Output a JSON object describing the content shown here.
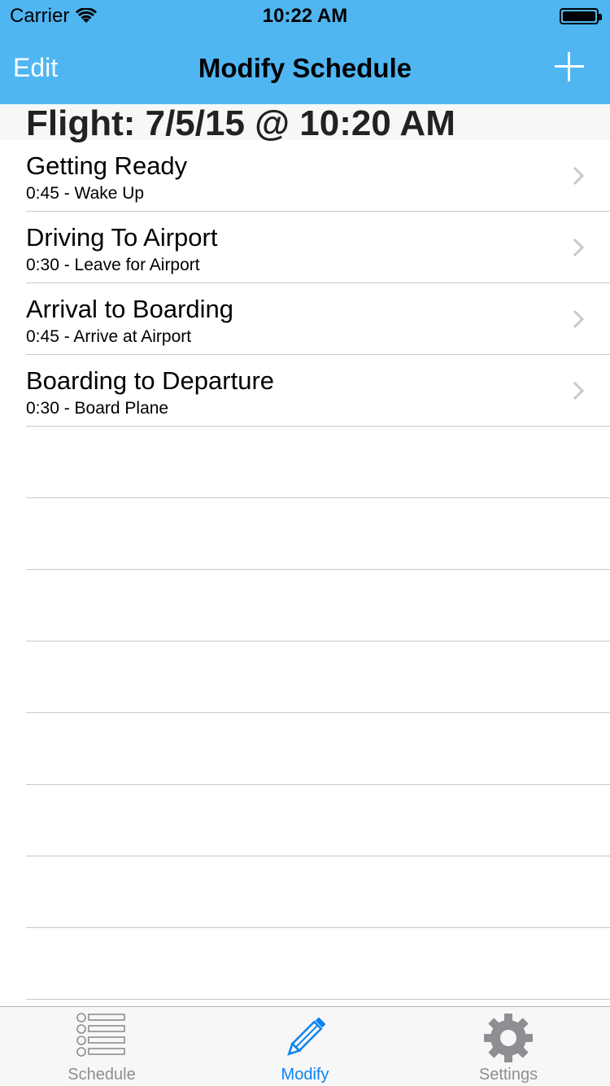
{
  "status": {
    "carrier": "Carrier",
    "time": "10:22 AM"
  },
  "nav": {
    "left": "Edit",
    "title": "Modify Schedule",
    "right_icon": "plus-icon"
  },
  "section": {
    "title": "Flight: 7/5/15 @ 10:20 AM"
  },
  "rows": [
    {
      "title": "Getting Ready",
      "subtitle": "0:45 - Wake Up"
    },
    {
      "title": "Driving To Airport",
      "subtitle": "0:30 - Leave for Airport"
    },
    {
      "title": "Arrival to Boarding",
      "subtitle": "0:45 - Arrive at Airport"
    },
    {
      "title": "Boarding to Departure",
      "subtitle": "0:30 - Board Plane"
    }
  ],
  "tabs": [
    {
      "label": "Schedule",
      "icon": "list-icon",
      "active": false
    },
    {
      "label": "Modify",
      "icon": "pencil-icon",
      "active": true
    },
    {
      "label": "Settings",
      "icon": "gear-icon",
      "active": false
    }
  ],
  "colors": {
    "nav_bg": "#4fb6f2",
    "accent": "#0a84f0",
    "inactive": "#8e8e93"
  }
}
